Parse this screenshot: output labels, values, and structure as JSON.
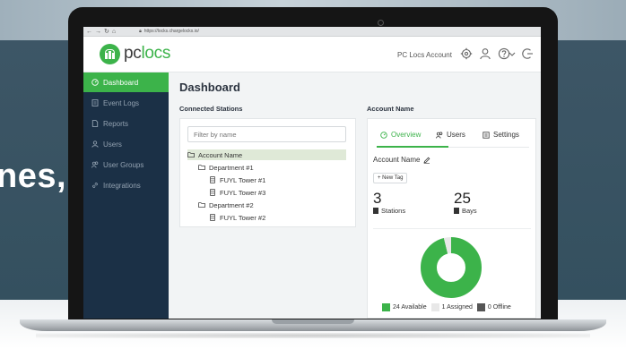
{
  "backdrop": {
    "headline": "nes,"
  },
  "browser": {
    "url": "https://locks.chargelocks.io/"
  },
  "brand": {
    "logo_pc": "pc",
    "logo_locs": "locs"
  },
  "header": {
    "account_label": "PC Locs Account"
  },
  "sidebar": {
    "items": [
      {
        "label": "Dashboard",
        "icon": "dashboard-icon",
        "active": true
      },
      {
        "label": "Event Logs",
        "icon": "log-icon"
      },
      {
        "label": "Reports",
        "icon": "report-icon"
      },
      {
        "label": "Users",
        "icon": "user-icon"
      },
      {
        "label": "User Groups",
        "icon": "users-icon"
      },
      {
        "label": "Integrations",
        "icon": "link-icon"
      }
    ]
  },
  "main": {
    "title": "Dashboard",
    "connected_stations": {
      "heading": "Connected Stations",
      "filter_placeholder": "Filter by name",
      "tree": [
        {
          "label": "Account Name",
          "type": "folder",
          "level": 0,
          "selected": true
        },
        {
          "label": "Department #1",
          "type": "folder",
          "level": 1
        },
        {
          "label": "FUYL Tower #1",
          "type": "station",
          "level": 2
        },
        {
          "label": "FUYL Tower #3",
          "type": "station",
          "level": 2
        },
        {
          "label": "Department #2",
          "type": "folder",
          "level": 1
        },
        {
          "label": "FUYL Tower #2",
          "type": "station",
          "level": 2
        }
      ]
    },
    "account_panel": {
      "heading": "Account Name",
      "tabs": [
        {
          "label": "Overview",
          "icon": "overview-icon",
          "active": true
        },
        {
          "label": "Users",
          "icon": "users-icon"
        },
        {
          "label": "Settings",
          "icon": "settings-icon"
        }
      ],
      "account_name": "Account Name",
      "new_tag_label": "+ New Tag",
      "stats": [
        {
          "value": "3",
          "label": "Stations"
        },
        {
          "value": "25",
          "label": "Bays"
        }
      ]
    }
  },
  "chart_data": {
    "type": "pie",
    "title": "",
    "categories": [
      "Available",
      "Assigned",
      "Offline"
    ],
    "values": [
      24,
      1,
      0
    ],
    "colors": [
      "#3cb34a",
      "#e8e8e8",
      "#555555"
    ],
    "legend_labels": [
      "24 Available",
      "1 Assigned",
      "0 Offline"
    ],
    "legend": "bottom"
  }
}
